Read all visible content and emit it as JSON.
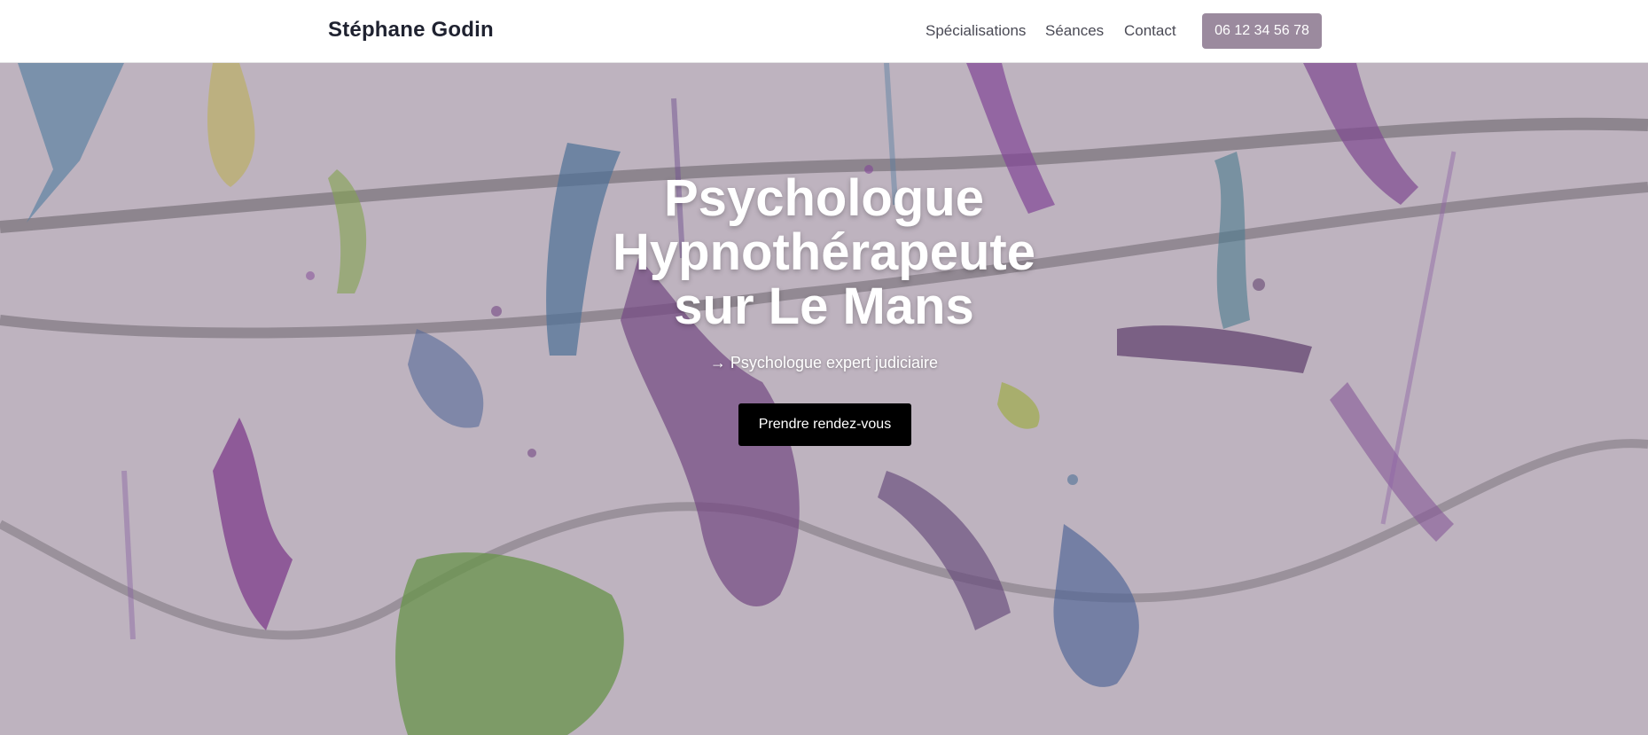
{
  "header": {
    "brand": "Stéphane Godin",
    "nav": [
      "Spécialisations",
      "Séances",
      "Contact"
    ],
    "phone_button": "06 12 34 56 78"
  },
  "hero": {
    "title_lines": [
      "Psychologue",
      "Hypnothérapeute",
      "sur Le Mans"
    ],
    "subtitle": "→ Psychologue expert judiciaire",
    "cta_label": "Prendre rendez-vous"
  },
  "colors": {
    "accent": "#9b8a9e",
    "cta_bg": "#000000",
    "header_bg": "#ffffff"
  }
}
